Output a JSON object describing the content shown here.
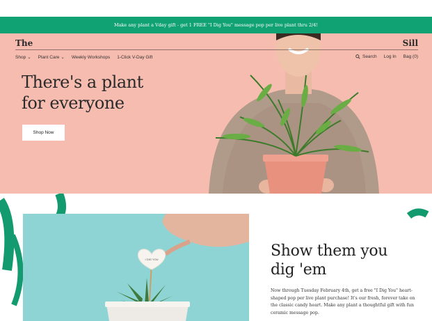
{
  "promo": {
    "text": "Make any plant a Vday gift - get 1 FREE \"I Dig You\" message pop per live plant thru 2/4!"
  },
  "header": {
    "brand_left": "The",
    "brand_right": "Sill",
    "nav": [
      {
        "label": "Shop",
        "dropdown": true
      },
      {
        "label": "Plant Care",
        "dropdown": true
      },
      {
        "label": "Weekly Workshops",
        "dropdown": false
      },
      {
        "label": "1-Click V-Day Gift",
        "dropdown": false
      }
    ],
    "search_label": "Search",
    "login_label": "Log In",
    "bag_label": "Bag (0)"
  },
  "hero": {
    "headline_line1": "There's a plant",
    "headline_line2": "for everyone",
    "cta_label": "Shop Now"
  },
  "promo_section": {
    "title_line1": "Show them you",
    "title_line2": "dig 'em",
    "body": "Now through Tuesday February 4th, get a free \"I Dig You\" heart-shaped pop per live plant purchase! It's our fresh, forever take on the classic candy heart. Make any plant a thoughtful gift with fun ceramic message pop.",
    "heart_text": "I DIG YOU"
  },
  "colors": {
    "promo_bar": "#11a274",
    "hero_bg": "#f7bcb0",
    "photo_bg": "#8ed4d5"
  }
}
